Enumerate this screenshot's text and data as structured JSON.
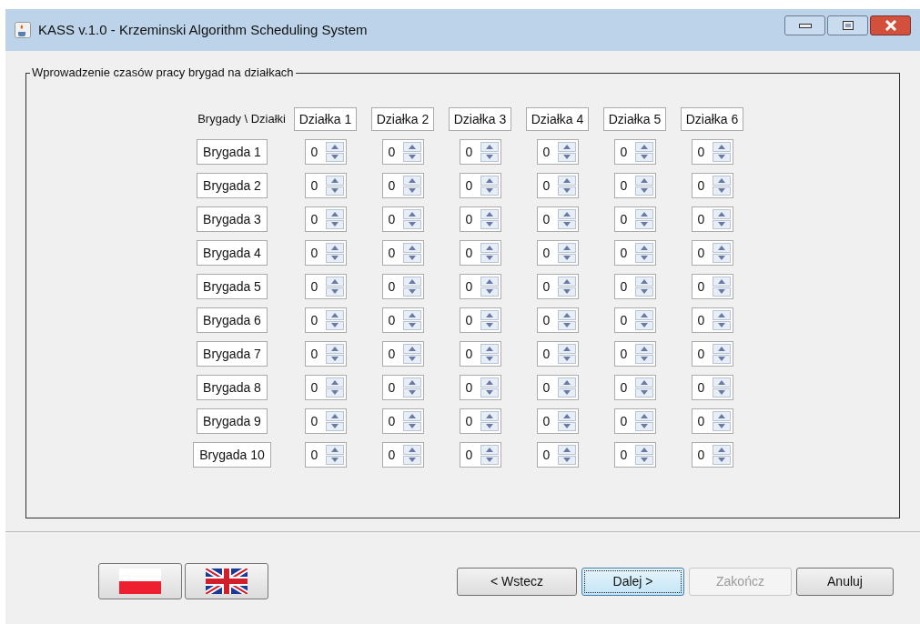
{
  "window": {
    "title": "KASS v.1.0 - Krzeminski Algorithm Scheduling System"
  },
  "panel": {
    "title": "Wprowadzenie czasów pracy brygad na działkach",
    "corner_label": "Brygady \\ Działki",
    "columns": [
      "Działka 1",
      "Działka 2",
      "Działka 3",
      "Działka 4",
      "Działka 5",
      "Działka 6"
    ],
    "rows": [
      {
        "label": "Brygada 1",
        "values": [
          "0",
          "0",
          "0",
          "0",
          "0",
          "0"
        ]
      },
      {
        "label": "Brygada 2",
        "values": [
          "0",
          "0",
          "0",
          "0",
          "0",
          "0"
        ]
      },
      {
        "label": "Brygada 3",
        "values": [
          "0",
          "0",
          "0",
          "0",
          "0",
          "0"
        ]
      },
      {
        "label": "Brygada 4",
        "values": [
          "0",
          "0",
          "0",
          "0",
          "0",
          "0"
        ]
      },
      {
        "label": "Brygada 5",
        "values": [
          "0",
          "0",
          "0",
          "0",
          "0",
          "0"
        ]
      },
      {
        "label": "Brygada 6",
        "values": [
          "0",
          "0",
          "0",
          "0",
          "0",
          "0"
        ]
      },
      {
        "label": "Brygada 7",
        "values": [
          "0",
          "0",
          "0",
          "0",
          "0",
          "0"
        ]
      },
      {
        "label": "Brygada 8",
        "values": [
          "0",
          "0",
          "0",
          "0",
          "0",
          "0"
        ]
      },
      {
        "label": "Brygada 9",
        "values": [
          "0",
          "0",
          "0",
          "0",
          "0",
          "0"
        ]
      },
      {
        "label": "Brygada 10",
        "values": [
          "0",
          "0",
          "0",
          "0",
          "0",
          "0"
        ]
      }
    ]
  },
  "buttons": [
    {
      "label": "< Wstecz",
      "focused": false,
      "disabled": false
    },
    {
      "label": "Dalej >",
      "focused": true,
      "disabled": false
    },
    {
      "label": "Zakończ",
      "focused": false,
      "disabled": true
    },
    {
      "label": "Anuluj",
      "focused": false,
      "disabled": false
    }
  ]
}
